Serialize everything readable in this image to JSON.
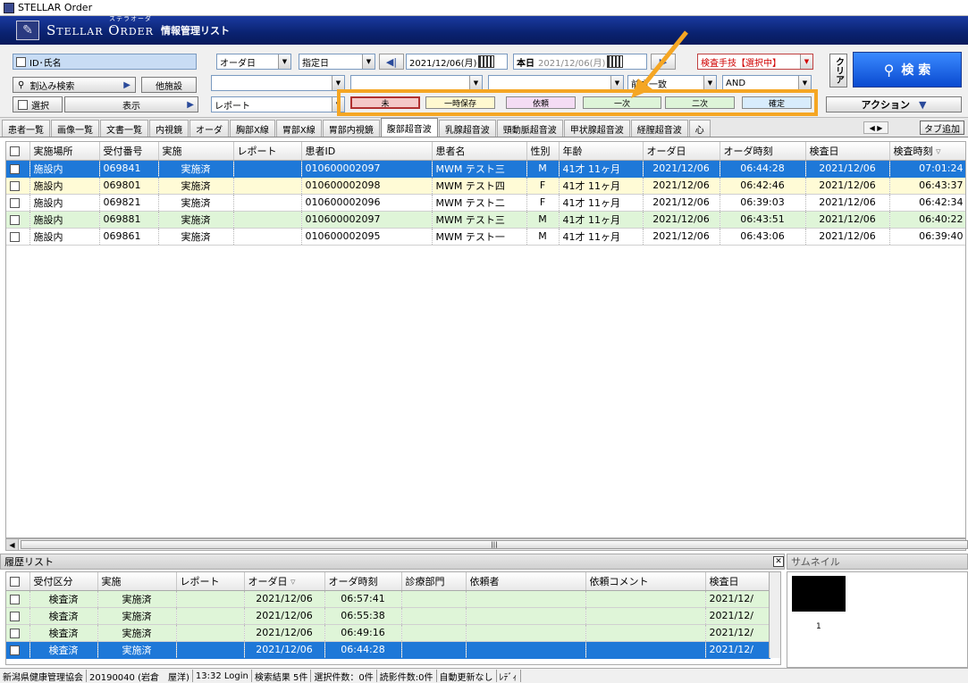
{
  "window": {
    "title": "STELLAR Order"
  },
  "banner": {
    "brand": "Stellar Order",
    "brand_kana": "ステラオーダー",
    "subtitle": "情報管理リスト"
  },
  "toolbar": {
    "id_name_label": "ID･氏名",
    "refine_search": "割込み検索",
    "other_facility": "他施設",
    "select": "選択",
    "display": "表示",
    "report_field": "レポート",
    "order_date_select": "オーダ日",
    "date_mode_select": "指定日",
    "date_from": "2021/12/06(月)",
    "today_label": "本日",
    "date_to": "2021/12/06(月)",
    "exam_tech_label": "検査手技【選択中】",
    "front_match": "前方一致",
    "and_select": "AND",
    "clear": "クリア",
    "search": "検 索",
    "action": "アクション"
  },
  "status_filters": [
    {
      "label": "未",
      "color": "#f4c8c8"
    },
    {
      "label": "一時保存",
      "color": "#fff9d0"
    },
    {
      "label": "依頼",
      "color": "#f4dcf4"
    },
    {
      "label": "一次",
      "color": "#ddf4d8"
    },
    {
      "label": "二次",
      "color": "#ddf4d8"
    },
    {
      "label": "確定",
      "color": "#d8ecfc"
    }
  ],
  "tabs": [
    {
      "label": "患者一覧"
    },
    {
      "label": "画像一覧"
    },
    {
      "label": "文書一覧"
    },
    {
      "label": "内視鏡"
    },
    {
      "label": "オーダ"
    },
    {
      "label": "胸部X線"
    },
    {
      "label": "胃部X線"
    },
    {
      "label": "胃部内視鏡"
    },
    {
      "label": "腹部超音波",
      "active": true
    },
    {
      "label": "乳腺超音波"
    },
    {
      "label": "頸動脈超音波"
    },
    {
      "label": "甲状腺超音波"
    },
    {
      "label": "経膣超音波"
    },
    {
      "label": "心"
    }
  ],
  "tab_add": "タブ追加",
  "main_list": {
    "columns": [
      "実施場所",
      "受付番号",
      "実施",
      "レポート",
      "患者ID",
      "患者名",
      "性別",
      "年齢",
      "オーダ日",
      "オーダ時刻",
      "検査日",
      "検査時刻"
    ],
    "rows": [
      {
        "style": "sel",
        "cells": [
          "施設内",
          "069841",
          "実施済",
          "",
          "010600002097",
          "MWM テスト三",
          "M",
          "41才 11ヶ月",
          "2021/12/06",
          "06:44:28",
          "2021/12/06",
          "07:01:24"
        ]
      },
      {
        "style": "yel",
        "cells": [
          "施設内",
          "069801",
          "実施済",
          "",
          "010600002098",
          "MWM テスト四",
          "F",
          "41才 11ヶ月",
          "2021/12/06",
          "06:42:46",
          "2021/12/06",
          "06:43:37"
        ]
      },
      {
        "style": "wht",
        "cells": [
          "施設内",
          "069821",
          "実施済",
          "",
          "010600002096",
          "MWM テスト二",
          "F",
          "41才 11ヶ月",
          "2021/12/06",
          "06:39:03",
          "2021/12/06",
          "06:42:34"
        ]
      },
      {
        "style": "grn",
        "cells": [
          "施設内",
          "069881",
          "実施済",
          "",
          "010600002097",
          "MWM テスト三",
          "M",
          "41才 11ヶ月",
          "2021/12/06",
          "06:43:51",
          "2021/12/06",
          "06:40:22"
        ]
      },
      {
        "style": "wht",
        "cells": [
          "施設内",
          "069861",
          "実施済",
          "",
          "010600002095",
          "MWM テスト一",
          "M",
          "41才 11ヶ月",
          "2021/12/06",
          "06:43:06",
          "2021/12/06",
          "06:39:40"
        ]
      }
    ]
  },
  "history": {
    "title": "履歴リスト",
    "columns": [
      "受付区分",
      "実施",
      "レポート",
      "オーダ日",
      "オーダ時刻",
      "診療部門",
      "依頼者",
      "依頼コメント",
      "検査日"
    ],
    "rows": [
      {
        "style": "grn",
        "cells": [
          "検査済",
          "実施済",
          "",
          "2021/12/06",
          "06:57:41",
          "",
          "",
          "",
          "2021/12/"
        ]
      },
      {
        "style": "grn",
        "cells": [
          "検査済",
          "実施済",
          "",
          "2021/12/06",
          "06:55:38",
          "",
          "",
          "",
          "2021/12/"
        ]
      },
      {
        "style": "grn",
        "cells": [
          "検査済",
          "実施済",
          "",
          "2021/12/06",
          "06:49:16",
          "",
          "",
          "",
          "2021/12/"
        ]
      },
      {
        "style": "sel",
        "cells": [
          "検査済",
          "実施済",
          "",
          "2021/12/06",
          "06:44:28",
          "",
          "",
          "",
          "2021/12/"
        ]
      }
    ]
  },
  "thumbnail": {
    "title": "サムネイル",
    "index": "1"
  },
  "statusbar": {
    "org": "新潟県健康管理協会",
    "user": "20190040 (岩倉　屋洋)",
    "login": "13:32 Login",
    "results": "検索結果 5件",
    "selected": "選択件数：0件",
    "reading": "読影件数:0件",
    "auto_update": "自動更新なし",
    "ready": "ﾚﾃﾞｨ"
  }
}
